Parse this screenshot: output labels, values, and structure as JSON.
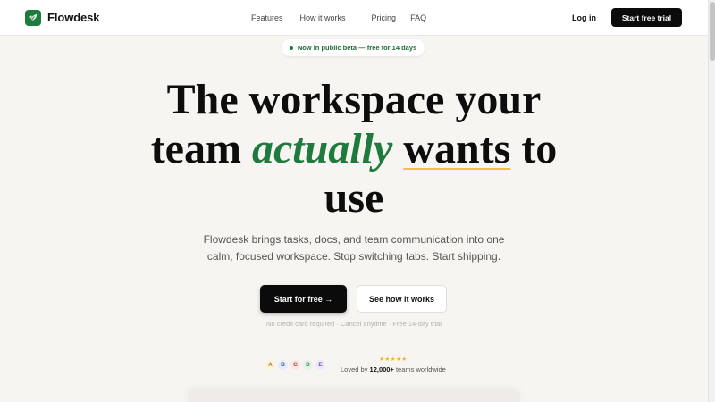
{
  "brand": {
    "name": "Flowdesk",
    "logo_icon": "leaf-icon",
    "accent": "#1f7a3e"
  },
  "nav": {
    "links": [
      "Features",
      "How it works",
      "Pricing",
      "FAQ"
    ],
    "login": "Log in",
    "cta": "Start free trial"
  },
  "badge": {
    "text": "Now in public beta — free for 14 days"
  },
  "hero": {
    "line1": "The workspace your",
    "line2_pre": "team ",
    "line2_accent": "actually",
    "line2_space": " ",
    "line2_underlined": "wants",
    "line2_post": " to",
    "line3": "use",
    "sub_line1": "Flowdesk brings tasks, docs, and team communication into one",
    "sub_line2": "calm, focused workspace. Stop switching tabs. Start shipping.",
    "cta_primary": "Start for free →",
    "cta_secondary": "See how it works",
    "fine_print": "No credit card required · Cancel anytime · Free 14-day trial"
  },
  "social_proof": {
    "avatars": [
      "A",
      "B",
      "C",
      "D",
      "E"
    ],
    "stars": "★★★★★",
    "loved_pre": "Loved by ",
    "loved_count": "12,000+",
    "loved_post": " teams worldwide"
  }
}
